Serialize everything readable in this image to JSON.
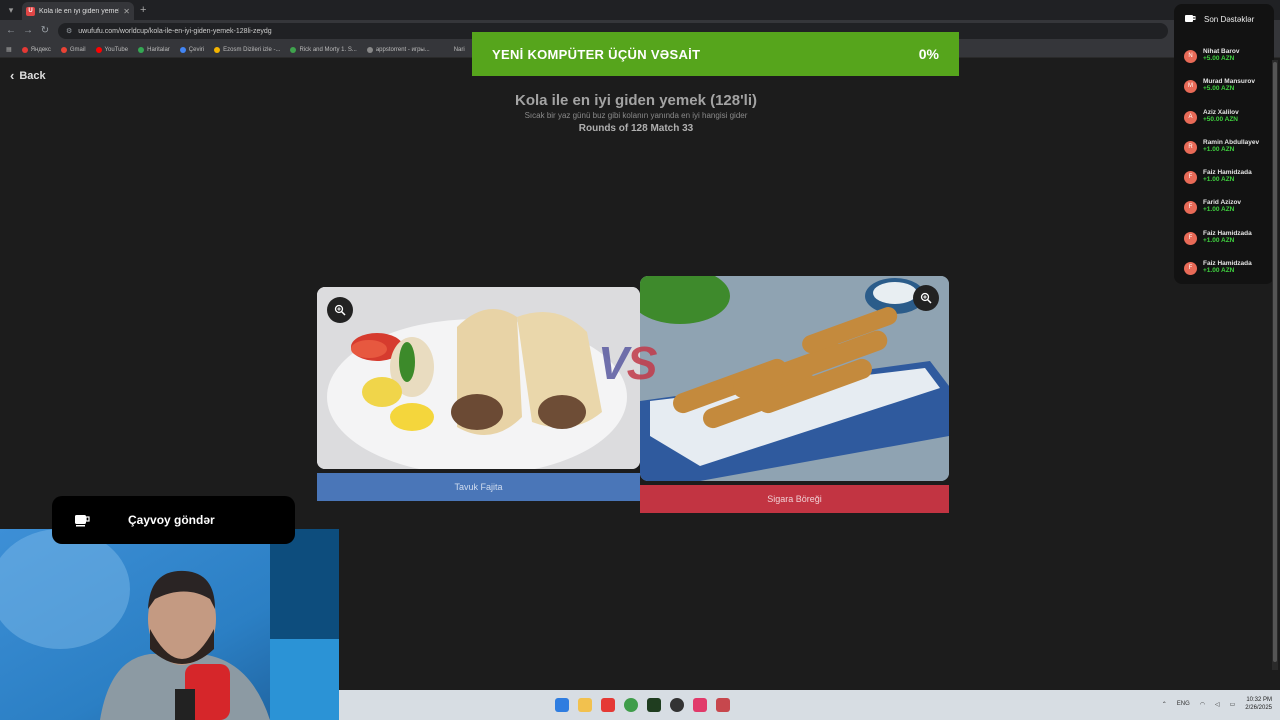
{
  "browser": {
    "tab_title": "Kola ile en iyi giden yemek (128...",
    "tab_favicon_letter": "U",
    "url": "uwufufu.com/worldcup/kola-ile-en-iyi-giden-yemek-128li-zeydg",
    "bookmarks": [
      {
        "label": "Яндекс",
        "color": "#e53935"
      },
      {
        "label": "Gmail",
        "color": "#ea4335"
      },
      {
        "label": "YouTube",
        "color": "#ff0000"
      },
      {
        "label": "Haritalar",
        "color": "#34a853"
      },
      {
        "label": "Çeviri",
        "color": "#4285f4"
      },
      {
        "label": "Ezosm Dizileri izle -...",
        "color": "#f4b400"
      },
      {
        "label": "Rick and Morty 1. S...",
        "color": "#3fa34d"
      },
      {
        "label": "appstorrent - игры...",
        "color": "#888888"
      },
      {
        "label": "Nari",
        "color": "#777777"
      }
    ]
  },
  "page": {
    "back_label": "Back",
    "title": "Kola ile en iyi giden yemek (128'li)",
    "subtitle": "Sıcak bir yaz günü buz gibi kolanın yanında en iyi hangisi gider",
    "round_info": "Rounds of 128 Match 33",
    "vs_left": "V",
    "vs_right": "S",
    "choices": [
      {
        "label": "Tavuk Fajita",
        "color": "#4a76b8"
      },
      {
        "label": "Sigara Böreği",
        "color": "#c23442"
      }
    ]
  },
  "banner": {
    "text": "YENİ KOMPÜTER ÜÇÜN VƏSAİT",
    "progress": "0%",
    "progress_value": 0,
    "color": "#56a51c"
  },
  "supporters": {
    "title": "Son Dəstəklər",
    "items": [
      {
        "initial": "N",
        "name": "Nihat Barov",
        "amount": "+5.00 AZN"
      },
      {
        "initial": "M",
        "name": "Murad Mansurov",
        "amount": "+5.00 AZN"
      },
      {
        "initial": "A",
        "name": "Aziz Xalilov",
        "amount": "+50.00 AZN"
      },
      {
        "initial": "R",
        "name": "Ramin Abdullayev",
        "amount": "+1.00 AZN"
      },
      {
        "initial": "F",
        "name": "Faiz Hamidzada",
        "amount": "+1.00 AZN"
      },
      {
        "initial": "F",
        "name": "Farid Azizov",
        "amount": "+1.00 AZN"
      },
      {
        "initial": "F",
        "name": "Faiz Hamidzada",
        "amount": "+1.00 AZN"
      },
      {
        "initial": "F",
        "name": "Faiz Hamidzada",
        "amount": "+1.00 AZN"
      }
    ]
  },
  "tea_overlay": {
    "text": "Çayvoy göndər"
  },
  "taskbar": {
    "lang": "ENG",
    "time": "10:32 PM",
    "date": "2/26/2025"
  }
}
